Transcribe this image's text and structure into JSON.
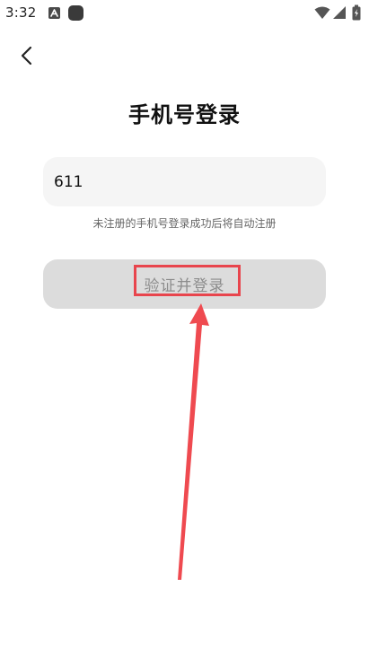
{
  "status_bar": {
    "time": "3:32",
    "notification_icon": "a-letter-icon",
    "app_icon": "rounded-square-icon",
    "wifi_icon": "wifi-icon",
    "signal_icon": "signal-icon",
    "battery_icon": "battery-icon"
  },
  "header": {
    "back_icon": "chevron-left-icon",
    "title": "手机号登录"
  },
  "form": {
    "phone_value": "611",
    "hint": "未注册的手机号登录成功后将自动注册",
    "submit_label": "验证并登录"
  },
  "colors": {
    "annotation": "#e8454d",
    "button_bg": "#dcdcdc",
    "input_bg": "#f5f5f5"
  }
}
